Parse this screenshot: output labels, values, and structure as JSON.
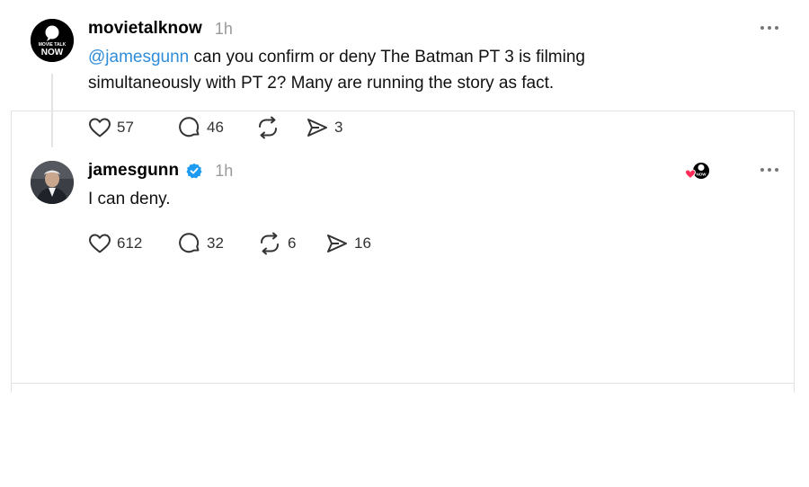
{
  "posts": [
    {
      "username": "movietalknow",
      "time": "1h",
      "avatar_text_top": "MOVIE TALK",
      "avatar_text_bottom": "NOW",
      "mention": "@jamesgunn",
      "text_line1": " can you confirm or deny The Batman PT 3 is filming",
      "text_line2": "simultaneously with PT 2? Many are running the story as fact.",
      "likes": "57",
      "replies": "46",
      "reposts": "",
      "shares": "3"
    },
    {
      "username": "jamesgunn",
      "verified": true,
      "time": "1h",
      "text": "I can deny.",
      "likes": "612",
      "replies": "32",
      "reposts": "6",
      "shares": "16",
      "liked_by_badge_text": "NOW"
    }
  ],
  "colors": {
    "mention": "#2f8dd9",
    "verified": "#1d9bf0",
    "heart": "#ff2d55"
  }
}
